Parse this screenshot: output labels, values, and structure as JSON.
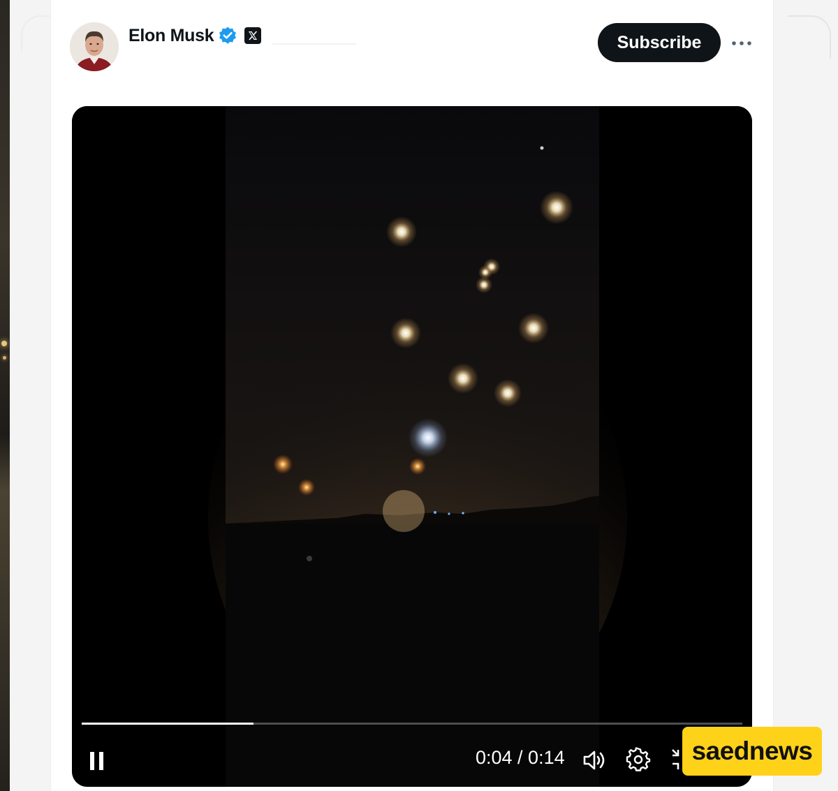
{
  "post": {
    "author_name": "Elon Musk",
    "verified_icon": "verified-badge-icon",
    "affiliation_icon": "x-logo-icon",
    "subscribe_label": "Subscribe",
    "more_icon": "more-horizontal-icon"
  },
  "video": {
    "progress": 0.26,
    "time_display": "0:04 / 0:14",
    "controls": {
      "pause_icon": "pause-icon",
      "volume_icon": "volume-icon",
      "settings_icon": "gear-icon",
      "fullscreen_icon": "exit-fullscreen-icon"
    }
  },
  "watermark": {
    "text": "saednews"
  },
  "colors": {
    "button_bg": "#0f1419",
    "verified_blue": "#1d9bf0",
    "watermark_bg": "#ffd21a"
  }
}
